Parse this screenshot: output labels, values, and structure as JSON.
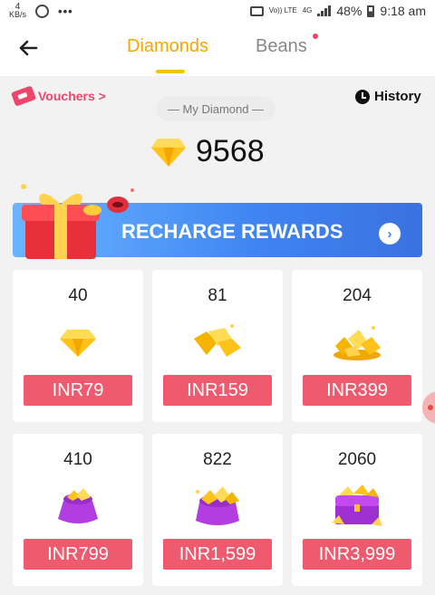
{
  "status_bar": {
    "kbs_value": "4",
    "kbs_unit": "KB/s",
    "overflow": "•••",
    "volte": "Vo)) LTE",
    "network": "4G",
    "battery": "48%",
    "time": "9:18 am"
  },
  "header": {
    "tabs": [
      {
        "label": "Diamonds",
        "active": true
      },
      {
        "label": "Beans",
        "active": false,
        "has_dot": true
      }
    ]
  },
  "wallet": {
    "vouchers_label": "Vouchers >",
    "history_label": "History",
    "my_diamond_label": "— My Diamond —",
    "balance": "9568"
  },
  "banner": {
    "label": "RECHARGE REWARDS"
  },
  "packages": [
    {
      "amount": "40",
      "price": "INR79",
      "icon": "single-diamond-icon"
    },
    {
      "amount": "81",
      "price": "INR159",
      "icon": "diamond-pile-icon"
    },
    {
      "amount": "204",
      "price": "INR399",
      "icon": "diamond-heap-icon"
    },
    {
      "amount": "410",
      "price": "INR799",
      "icon": "diamond-bag-icon"
    },
    {
      "amount": "822",
      "price": "INR1,599",
      "icon": "diamond-sack-icon"
    },
    {
      "amount": "2060",
      "price": "INR3,999",
      "icon": "treasure-chest-icon"
    }
  ],
  "colors": {
    "accent": "#f5a600",
    "price_button": "#f05a6e",
    "banner": "#3f84f2",
    "voucher": "#f0446b"
  }
}
